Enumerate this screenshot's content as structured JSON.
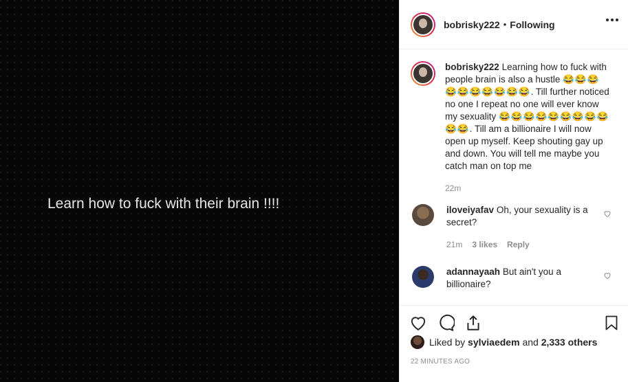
{
  "media": {
    "overlay_text": "Learn how to fuck with their brain !!!!"
  },
  "header": {
    "username": "bobrisky222",
    "separator": "•",
    "follow_status": "Following",
    "more_icon": "more-horizontal-icon"
  },
  "caption": {
    "username": "bobrisky222",
    "part1": "Learning how to fuck with people brain is also a hustle",
    "emoji_group1": "😂😂😂😂😂😂😂😂😂😂",
    "part2": ". Till further noticed no one I repeat no one will ever know my sexuality",
    "emoji_group2": "😂😂😂😂😂😂😂😂😂😂😂",
    "part3": ". Till am a billionaire I will now open up myself. Keep shouting gay up and down. You will tell me maybe you catch man on top me",
    "time": "22m"
  },
  "comments": [
    {
      "username": "iloveiyafav",
      "text": "Oh, your sexuality is a secret?",
      "time": "21m",
      "likes": "3 likes",
      "reply": "Reply"
    },
    {
      "username": "adannayaah",
      "text": "But ain't you a billionaire?"
    }
  ],
  "actions": {
    "icons": [
      "heart-icon",
      "comment-icon",
      "share-icon",
      "bookmark-icon"
    ]
  },
  "likes": {
    "prefix": "Liked by",
    "user": "sylviaedem",
    "middle": "and",
    "others": "2,333 others"
  },
  "timestamp": "22 MINUTES AGO"
}
